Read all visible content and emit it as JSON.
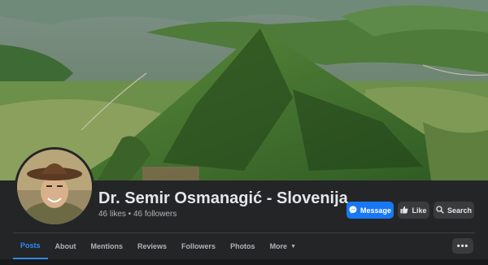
{
  "profile": {
    "name": "Dr. Semir Osmanagić - Slovenija",
    "stats": "46 likes • 46 followers"
  },
  "actions": {
    "message_label": "Message",
    "like_label": "Like",
    "search_label": "Search"
  },
  "tabs": [
    {
      "label": "Posts",
      "active": true
    },
    {
      "label": "About"
    },
    {
      "label": "Mentions"
    },
    {
      "label": "Reviews"
    },
    {
      "label": "Followers"
    },
    {
      "label": "Photos"
    },
    {
      "label": "More"
    }
  ],
  "more_menu_icon": "ellipsis-icon",
  "colors": {
    "accent": "#1877f2",
    "active_tab": "#2d88ff",
    "background": "#242526",
    "button_secondary": "#3a3b3c"
  }
}
